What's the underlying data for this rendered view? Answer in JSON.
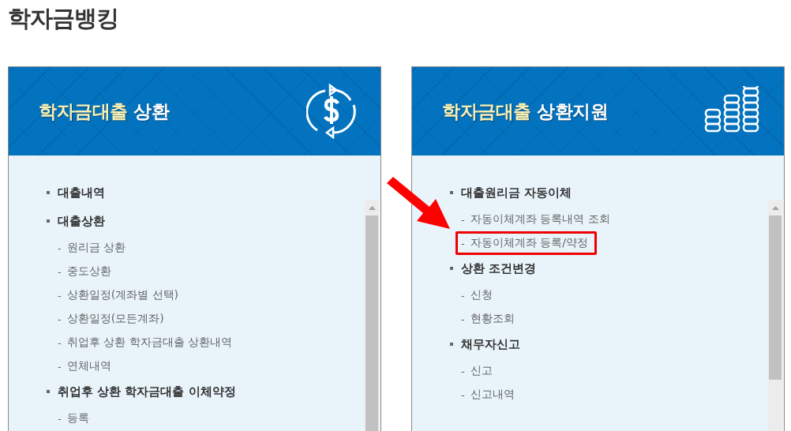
{
  "page_title": "학자금뱅킹",
  "pointer_arrow": true,
  "panels": [
    {
      "title": {
        "accent": "학자금대출",
        "rest": "상환"
      },
      "groups": [
        {
          "label": "대출내역"
        },
        {
          "label": "대출상환",
          "children": [
            {
              "marker": "-",
              "label": "원리금 상환",
              "highlighted": false
            },
            {
              "marker": "-",
              "label": "중도상환",
              "highlighted": false
            },
            {
              "marker": "-",
              "label": "상환일정(계좌별 선택)",
              "highlighted": false
            },
            {
              "marker": "-",
              "label": "상환일정(모든계좌)",
              "highlighted": false
            },
            {
              "marker": "-",
              "label": "취업후 상환 학자금대출 상환내역",
              "highlighted": false
            },
            {
              "marker": "-",
              "label": "연체내역",
              "highlighted": false
            }
          ]
        },
        {
          "label": "취업후 상환 학자금대출 이체약정",
          "children": [
            {
              "marker": "-",
              "label": "등록",
              "highlighted": false
            }
          ]
        }
      ]
    },
    {
      "title": {
        "accent": "학자금대출",
        "rest": "상환지원"
      },
      "groups": [
        {
          "label": "대출원리금 자동이체",
          "children": [
            {
              "marker": "-",
              "label": "자동이체계좌 등록내역 조회",
              "highlighted": false
            },
            {
              "marker": "-",
              "label": "자동이체계좌 등록/약정",
              "highlighted": true
            }
          ]
        },
        {
          "label": "상환 조건변경",
          "children": [
            {
              "marker": "-",
              "label": "신청",
              "highlighted": false
            },
            {
              "marker": "-",
              "label": "현황조회",
              "highlighted": false
            }
          ]
        },
        {
          "label": "채무자신고",
          "children": [
            {
              "marker": "-",
              "label": "신고",
              "highlighted": false
            },
            {
              "marker": "-",
              "label": "신고내역",
              "highlighted": false
            }
          ]
        }
      ]
    }
  ]
}
